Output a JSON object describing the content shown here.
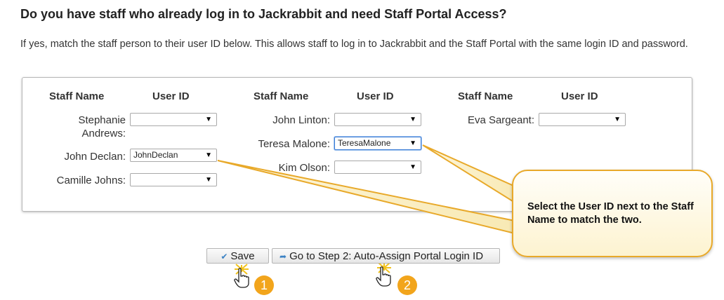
{
  "heading": "Do you have staff who already log in to Jackrabbit and need Staff Portal Access?",
  "description": "If yes, match the staff person to their user ID below. This allows staff to log in to Jackrabbit and the Staff Portal with the same login ID and password.",
  "columns": [
    {
      "staff_header": "Staff Name",
      "user_header": "User ID"
    },
    {
      "staff_header": "Staff Name",
      "user_header": "User ID"
    },
    {
      "staff_header": "Staff Name",
      "user_header": "User ID"
    }
  ],
  "staff": {
    "stephanie": {
      "name_line1": "Stephanie",
      "name_line2": "Andrews:",
      "user_id": ""
    },
    "john_declan": {
      "name": "John Declan:",
      "user_id": "JohnDeclan"
    },
    "camille": {
      "name": "Camille Johns:",
      "user_id": ""
    },
    "john_linton": {
      "name": "John Linton:",
      "user_id": ""
    },
    "teresa": {
      "name": "Teresa Malone:",
      "user_id": "TeresaMalone"
    },
    "kim": {
      "name": "Kim Olson:",
      "user_id": ""
    },
    "eva": {
      "name": "Eva Sargeant:",
      "user_id": ""
    }
  },
  "dropdown_arrow": "▼",
  "buttons": {
    "save": "Save",
    "step2": "Go to Step 2: Auto-Assign Portal Login ID"
  },
  "callout": "Select the User ID next to the Staff Name to match the two.",
  "badges": [
    "1",
    "2"
  ],
  "colors": {
    "callout_border": "#e8a92a",
    "badge": "#f2a51c",
    "focus": "#3b7cd6"
  }
}
